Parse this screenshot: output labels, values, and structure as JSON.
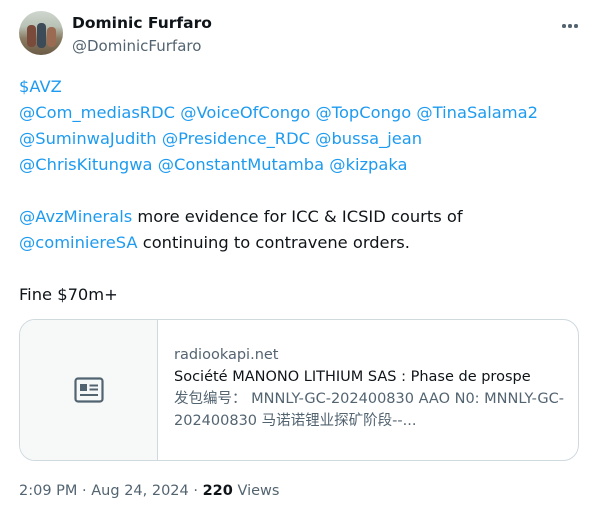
{
  "author": {
    "name": "Dominic Furfaro",
    "handle": "@DominicFurfaro"
  },
  "tweet": {
    "cashtag": "$AVZ",
    "mention_lines": [
      [
        "@Com_mediasRDC",
        "@VoiceOfCongo",
        "@TopCongo",
        "@TinaSalama2"
      ],
      [
        "@SuminwaJudith",
        "@Presidence_RDC",
        "@bussa_jean"
      ],
      [
        "@ChrisKitungwa",
        "@ConstantMutamba",
        "@kizpaka"
      ]
    ],
    "para2_mention1": "@AvzMinerals",
    "para2_text1": " more evidence for ICC & ICSID courts of",
    "para2_mention2": "@cominiereSA",
    "para2_text2": " continuing to contravene orders.",
    "fine_text": "Fine $70m+"
  },
  "link_card": {
    "domain": "radiookapi.net",
    "title": "Société MANONO LITHIUM SAS : Phase de prospe",
    "description": "发包编号： MNNLY-GC-202400830 AAO N0: MNNLY-GC-202400830 马诺诺锂业探矿阶段--..."
  },
  "meta": {
    "time": "2:09 PM",
    "separator": " · ",
    "date": "Aug 24, 2024",
    "views_count": "220",
    "views_label": " Views"
  },
  "icons": {
    "more": "more-horizontal-icon",
    "card_placeholder": "article-icon"
  },
  "colors": {
    "link": "#1d9bf0",
    "text": "#0f1419",
    "secondary": "#536471",
    "border": "#cfd9de"
  }
}
